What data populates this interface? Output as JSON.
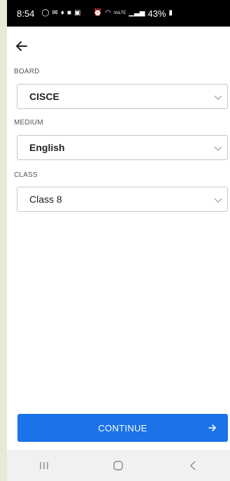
{
  "status_bar": {
    "time": "8:54",
    "network": "VoLTE",
    "battery": "43%",
    "icons": [
      "whatsapp-icon",
      "gmail-icon",
      "app-icon",
      "mail-icon",
      "image-icon",
      "alarm-icon",
      "wifi-icon",
      "signal-icon",
      "battery-icon"
    ]
  },
  "form": {
    "board": {
      "label": "BOARD",
      "value": "CISCE"
    },
    "medium": {
      "label": "MEDIUM",
      "value": "English"
    },
    "class": {
      "label": "CLASS",
      "value": "Class 8"
    }
  },
  "continue_label": "CONTINUE",
  "colors": {
    "primary": "#1a73e8",
    "border": "#c8c8c8",
    "side_background": "#e6ecd4"
  }
}
